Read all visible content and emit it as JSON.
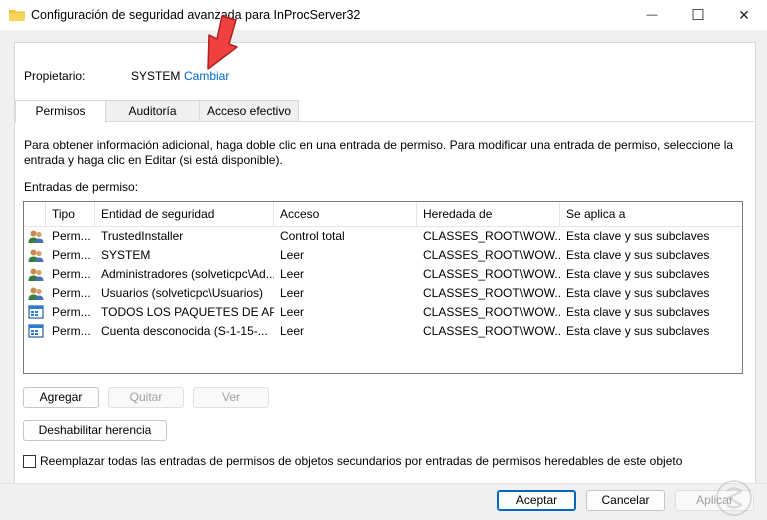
{
  "window": {
    "title": "Configuración de seguridad avanzada para InProcServer32",
    "minimize_glyph": "—",
    "maximize_glyph": "☐",
    "close_glyph": "✕"
  },
  "owner": {
    "label": "Propietario:",
    "value": "SYSTEM",
    "change_link": "Cambiar"
  },
  "tabs": [
    "Permisos",
    "Auditoría",
    "Acceso efectivo"
  ],
  "description": "Para obtener información adicional, haga doble clic en una entrada de permiso. Para modificar una entrada de permiso, seleccione la entrada y haga clic en Editar (si está disponible).",
  "entries_label": "Entradas de permiso:",
  "columns": [
    "Tipo",
    "Entidad de seguridad",
    "Acceso",
    "Heredada de",
    "Se aplica a"
  ],
  "rows": [
    {
      "icon": "user-group-icon",
      "type": "Perm...",
      "principal": "TrustedInstaller",
      "access": "Control total",
      "inherited": "CLASSES_ROOT\\WOW...",
      "applies": "Esta clave y sus subclaves"
    },
    {
      "icon": "user-group-icon",
      "type": "Perm...",
      "principal": "SYSTEM",
      "access": "Leer",
      "inherited": "CLASSES_ROOT\\WOW...",
      "applies": "Esta clave y sus subclaves"
    },
    {
      "icon": "user-group-icon",
      "type": "Perm...",
      "principal": "Administradores (solveticpc\\Ad...",
      "access": "Leer",
      "inherited": "CLASSES_ROOT\\WOW...",
      "applies": "Esta clave y sus subclaves"
    },
    {
      "icon": "user-group-icon",
      "type": "Perm...",
      "principal": "Usuarios (solveticpc\\Usuarios)",
      "access": "Leer",
      "inherited": "CLASSES_ROOT\\WOW...",
      "applies": "Esta clave y sus subclaves"
    },
    {
      "icon": "app-package-icon",
      "type": "Perm...",
      "principal": "TODOS LOS PAQUETES DE AP...",
      "access": "Leer",
      "inherited": "CLASSES_ROOT\\WOW...",
      "applies": "Esta clave y sus subclaves"
    },
    {
      "icon": "app-package-icon",
      "type": "Perm...",
      "principal": "Cuenta desconocida (S-1-15-...",
      "access": "Leer",
      "inherited": "CLASSES_ROOT\\WOW...",
      "applies": "Esta clave y sus subclaves"
    }
  ],
  "buttons": {
    "add": "Agregar",
    "remove": "Quitar",
    "view": "Ver",
    "disable_inheritance": "Deshabilitar herencia",
    "accept": "Aceptar",
    "cancel": "Cancelar",
    "apply": "Aplicar"
  },
  "replace_checkbox_label": "Reemplazar todas las entradas de permisos de objetos secundarios por entradas de permisos heredables de este objeto",
  "colors": {
    "accent": "#0067c0",
    "link": "#0066cc",
    "arrow": "#f04040"
  }
}
